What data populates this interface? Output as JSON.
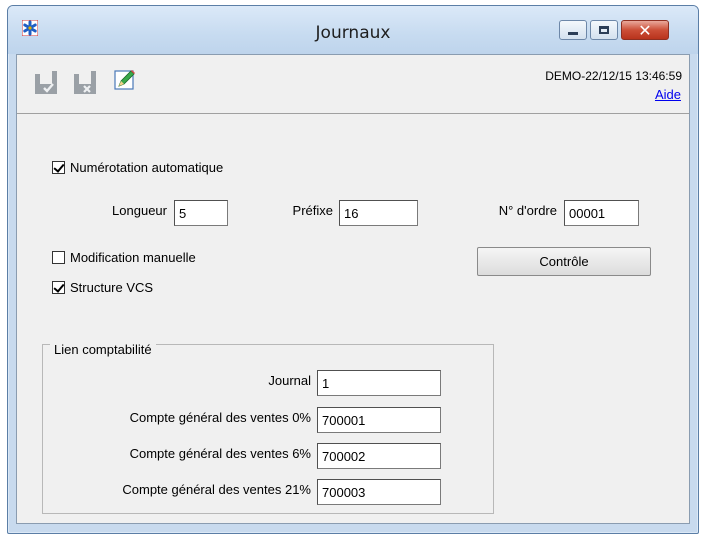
{
  "window": {
    "title": "Journaux",
    "app_icon": "asterisk-app-icon",
    "buttons": [
      "minimize-icon",
      "maximize-icon",
      "close-icon"
    ]
  },
  "toolbar": {
    "icons": [
      "save-check-icon",
      "save-cancel-icon",
      "pencil-edit-icon"
    ],
    "stamp": "DEMO-22/12/15 13:46:59",
    "help": "Aide"
  },
  "form": {
    "auto_numbering": {
      "label": "Numérotation automatique",
      "checked": true
    },
    "length": {
      "label": "Longueur",
      "value": "5"
    },
    "prefix": {
      "label": "Préfixe",
      "value": "16"
    },
    "order_number": {
      "label": "N° d'ordre",
      "value": "00001"
    },
    "manual_edit": {
      "label": "Modification manuelle",
      "checked": false
    },
    "vcs_structure": {
      "label": "Structure VCS",
      "checked": true
    },
    "control_button": "Contrôle"
  },
  "accounting": {
    "title": "Lien comptabilité",
    "journal": {
      "label": "Journal",
      "value": "1"
    },
    "sales_0": {
      "label": "Compte général des ventes 0%",
      "value": "700001"
    },
    "sales_6": {
      "label": "Compte général des ventes 6%",
      "value": "700002"
    },
    "sales_21": {
      "label": "Compte général des ventes 21%",
      "value": "700003"
    }
  }
}
